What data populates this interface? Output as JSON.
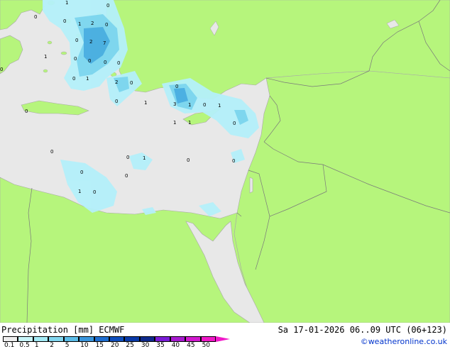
{
  "title": "Precipitation [mm]  ECMWF",
  "validity": "Sa 17-01-2026 06..09 UTC (06+123)",
  "credit": "©weatheronline.co.uk",
  "legend": {
    "ticks": [
      "0.1",
      "0.5",
      "1",
      "2",
      "5",
      "10",
      "15",
      "20",
      "25",
      "30",
      "35",
      "40",
      "45",
      "50"
    ],
    "colors": [
      "#eeeeee",
      "#c8f5f9",
      "#a4eaf5",
      "#82d6ef",
      "#5bbde8",
      "#3a96dd",
      "#1f6ed0",
      "#0f4fbe",
      "#0a3aa8",
      "#0e2a8c",
      "#7a1cd6",
      "#a81bd0",
      "#d21acf",
      "#f018c8"
    ]
  },
  "map_colors": {
    "land": "#b6f57c",
    "sea_no_precip": "#e8e8e8",
    "coast": "#a8a8a8",
    "border": "#7a7a7a",
    "rain_light": "#b4f0fa",
    "rain_mid": "#7cd5ee",
    "rain_heavy": "#4aaee0"
  },
  "precip_values": [
    "0",
    "1",
    "0",
    "0",
    "1",
    "2",
    "0",
    "0",
    "2",
    "7",
    "1",
    "0",
    "0",
    "0",
    "1",
    "0",
    "0",
    "0",
    "2",
    "0",
    "0",
    "1",
    "3",
    "1",
    "0",
    "1",
    "0",
    "1",
    "1",
    "0",
    "0",
    "1",
    "0",
    "0",
    "0",
    "1",
    "0",
    "0",
    "0"
  ]
}
